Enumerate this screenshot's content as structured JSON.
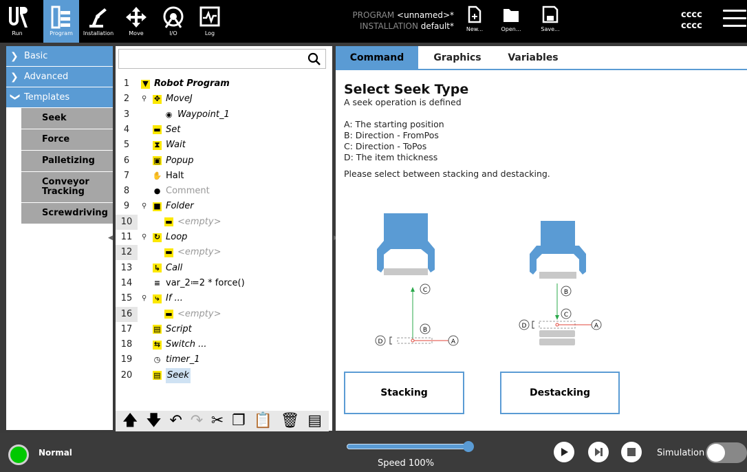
{
  "topbar": {
    "nav": [
      {
        "label": "Run",
        "icon": "ur-logo-icon"
      },
      {
        "label": "Program",
        "icon": "program-tree-icon"
      },
      {
        "label": "Installation",
        "icon": "robot-arm-icon"
      },
      {
        "label": "Move",
        "icon": "move-cross-icon"
      },
      {
        "label": "I/O",
        "icon": "io-icon"
      },
      {
        "label": "Log",
        "icon": "log-graph-icon"
      }
    ],
    "program_key": "PROGRAM",
    "program_value": "<unnamed>*",
    "installation_key": "INSTALLATION",
    "installation_value": "default*",
    "file_buttons": [
      {
        "label": "New...",
        "icon": "new-file-icon"
      },
      {
        "label": "Open...",
        "icon": "open-folder-icon"
      },
      {
        "label": "Save...",
        "icon": "save-disk-icon"
      }
    ],
    "user_line1": "cccc",
    "user_line2": "cccc"
  },
  "left_panel": {
    "categories": [
      {
        "label": "Basic",
        "expanded": false
      },
      {
        "label": "Advanced",
        "expanded": false
      },
      {
        "label": "Templates",
        "expanded": true
      }
    ],
    "templates": [
      "Seek",
      "Force",
      "Palletizing",
      "Conveyor Tracking",
      "Screwdriving"
    ]
  },
  "tree": {
    "search_placeholder": "",
    "rows": [
      {
        "num": "1",
        "label": "Robot Program",
        "icon": "program-triangle-icon",
        "style": "bolditalic"
      },
      {
        "num": "2",
        "label": "MoveJ",
        "icon": "move-icon",
        "style": "italic"
      },
      {
        "num": "3",
        "label": "Waypoint_1",
        "icon": "waypoint-icon",
        "style": "italic"
      },
      {
        "num": "4",
        "label": "Set",
        "icon": "set-icon",
        "style": "italic"
      },
      {
        "num": "5",
        "label": "Wait",
        "icon": "hourglass-icon",
        "style": "italic"
      },
      {
        "num": "6",
        "label": "Popup",
        "icon": "popup-icon",
        "style": "italic"
      },
      {
        "num": "7",
        "label": "Halt",
        "icon": "halt-hand-icon",
        "style": "normal"
      },
      {
        "num": "8",
        "label": "Comment",
        "icon": "comment-icon",
        "style": "gray"
      },
      {
        "num": "9",
        "label": "Folder",
        "icon": "folder-icon",
        "style": "italic"
      },
      {
        "num": "10",
        "label": "<empty>",
        "icon": "empty-icon",
        "style": "empty"
      },
      {
        "num": "11",
        "label": "Loop",
        "icon": "loop-icon",
        "style": "italic"
      },
      {
        "num": "12",
        "label": "<empty>",
        "icon": "empty-icon",
        "style": "empty"
      },
      {
        "num": "13",
        "label": "Call",
        "icon": "call-icon",
        "style": "italic"
      },
      {
        "num": "14",
        "label": "var_2≔2 * force()",
        "icon": "assignment-icon",
        "style": "normal"
      },
      {
        "num": "15",
        "label": "If ...",
        "icon": "if-icon",
        "style": "italic"
      },
      {
        "num": "16",
        "label": "<empty>",
        "icon": "empty-icon",
        "style": "empty"
      },
      {
        "num": "17",
        "label": "Script",
        "icon": "script-icon",
        "style": "italic"
      },
      {
        "num": "18",
        "label": "Switch ...",
        "icon": "switch-icon",
        "style": "italic"
      },
      {
        "num": "19",
        "label": "timer_1",
        "icon": "timer-icon",
        "style": "italic"
      },
      {
        "num": "20",
        "label": "Seek",
        "icon": "seek-icon",
        "style": "selected"
      }
    ],
    "toolbar": [
      "move-up-icon",
      "move-down-icon",
      "undo-icon",
      "redo-icon",
      "cut-icon",
      "copy-icon",
      "paste-icon",
      "delete-icon",
      "suppress-icon"
    ]
  },
  "right_panel": {
    "tabs": [
      "Command",
      "Graphics",
      "Variables"
    ],
    "active_tab": "Command",
    "title": "Select Seek Type",
    "subtitle": "A seek operation is defined",
    "definitions": [
      "A: The starting position",
      "B: Direction - FromPos",
      "C: Direction - ToPos",
      "D: The item thickness"
    ],
    "instruction": "Please select between stacking and destacking.",
    "diagram_labels": {
      "a": "A",
      "b": "B",
      "c": "C",
      "d": "D"
    },
    "stacking_label": "Stacking",
    "destacking_label": "Destacking",
    "colors": {
      "gripper": "#5a9bd4",
      "arrow": "#2aa84a",
      "point": "#e0443a",
      "item": "#c8c8c8"
    }
  },
  "bottombar": {
    "status": "Normal",
    "speed_text": "Speed 100%",
    "speed_fraction": 1.0,
    "simulation_label": "Simulation",
    "simulation_on": false
  }
}
